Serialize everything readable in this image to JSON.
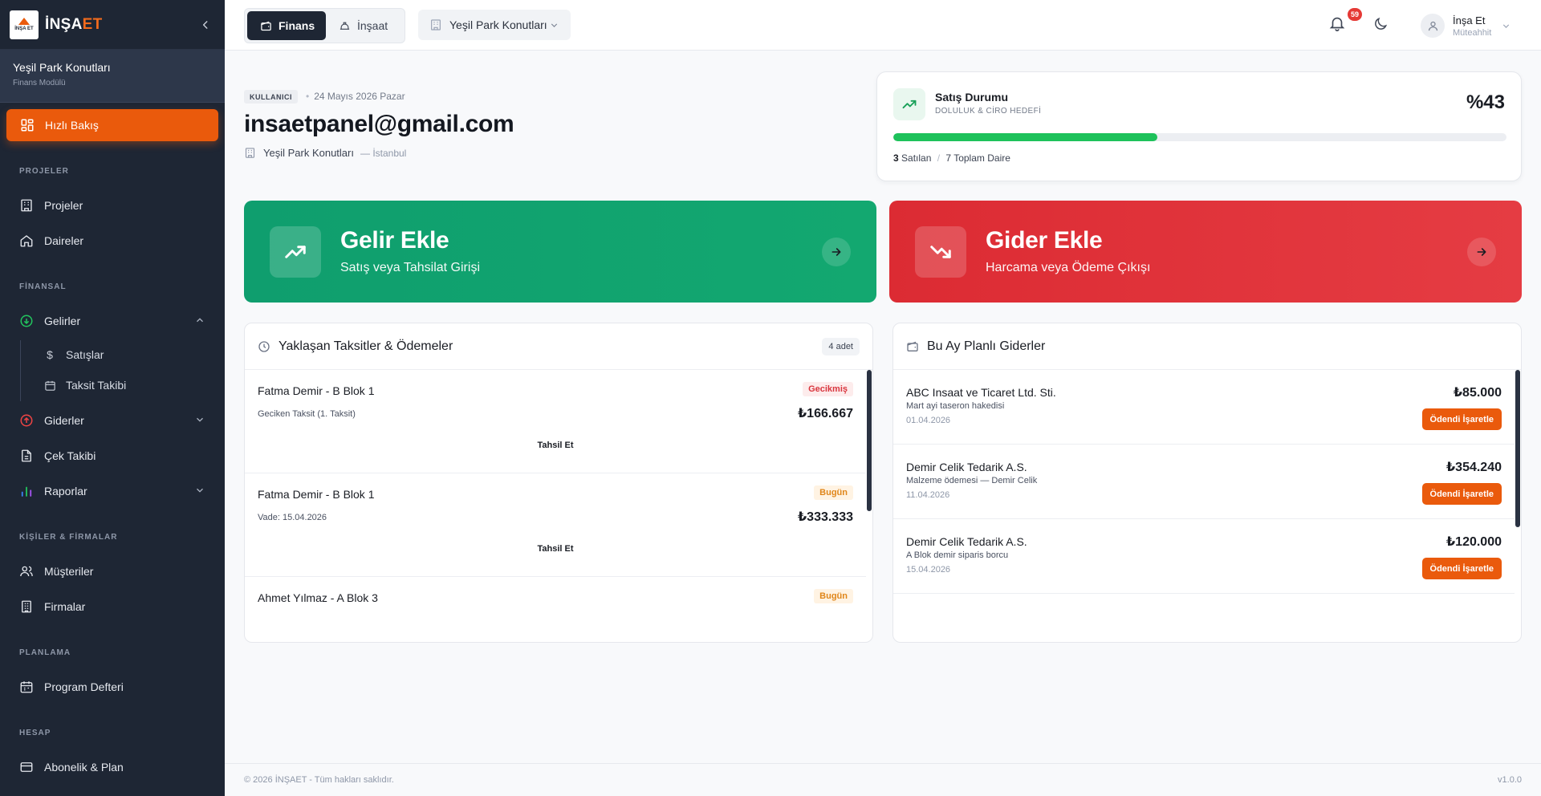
{
  "app": {
    "logo_small": "İNŞA ET",
    "logo_main": "İNŞA",
    "logo_accent": "ET"
  },
  "sidebar": {
    "project_name": "Yeşil Park Konutları",
    "project_module": "Finans Modülü",
    "active_item": "Hızlı Bakış",
    "sections": {
      "projects": "PROJELER",
      "finance": "FİNANSAL",
      "people": "KİŞİLER & FİRMALAR",
      "planning": "PLANLAMA",
      "account": "HESAP"
    },
    "items": {
      "projeler": "Projeler",
      "daireler": "Daireler",
      "gelirler": "Gelirler",
      "satislar": "Satışlar",
      "taksit_takibi": "Taksit Takibi",
      "giderler": "Giderler",
      "cek_takibi": "Çek Takibi",
      "raporlar": "Raporlar",
      "musteriler": "Müşteriler",
      "firmalar": "Firmalar",
      "program_defteri": "Program Defteri",
      "abonelik": "Abonelik & Plan"
    }
  },
  "topbar": {
    "mode_finance": "Finans",
    "mode_construction": "İnşaat",
    "project_select": "Yeşil Park Konutları",
    "notification_count": "59",
    "user_name": "İnşa Et",
    "user_role": "Müteahhit"
  },
  "header": {
    "role_chip": "KULLANICI",
    "date": "24 Mayıs 2026 Pazar",
    "email": "insaetpanel@gmail.com",
    "project": "Yeşil Park Konutları",
    "city": "— İstanbul"
  },
  "sales": {
    "title": "Satış Durumu",
    "subtitle": "DOLULUK & CİRO HEDEFİ",
    "percent_label": "%43",
    "progress_fraction": 0.43,
    "sold_count": "3",
    "sold_label": "Satılan",
    "total_label": "7 Toplam Daire",
    "accent": "#1ec25b"
  },
  "actions": {
    "income_title": "Gelir Ekle",
    "income_sub": "Satış veya Tahsilat Girişi",
    "expense_title": "Gider Ekle",
    "expense_sub": "Harcama veya Ödeme Çıkışı",
    "income_color": "#0f9e6e",
    "expense_color": "#dc2b33"
  },
  "installments": {
    "title": "Yaklaşan Taksitler & Ödemeler",
    "count": "4 adet",
    "collect_label": "Tahsil Et",
    "rows": [
      {
        "who": "Fatma Demir - B Blok 1",
        "status": "Gecikmiş",
        "desc": "Geciken Taksit (1. Taksit)",
        "amount": "₺166.667"
      },
      {
        "who": "Fatma Demir - B Blok 1",
        "status": "Bugün",
        "desc": "Vade: 15.04.2026",
        "amount": "₺333.333"
      },
      {
        "who": "Ahmet Yılmaz - A Blok 3",
        "status": "Bugün"
      }
    ]
  },
  "expenses": {
    "title": "Bu Ay Planlı Giderler",
    "mark_label": "Ödendi İşaretle",
    "rows": [
      {
        "firm": "ABC Insaat ve Ticaret Ltd. Sti.",
        "note": "Mart ayi taseron hakedisi",
        "date": "01.04.2026",
        "amount": "₺85.000"
      },
      {
        "firm": "Demir Celik Tedarik A.S.",
        "note": "Malzeme ödemesi — Demir Celik",
        "date": "11.04.2026",
        "amount": "₺354.240"
      },
      {
        "firm": "Demir Celik Tedarik A.S.",
        "note": "A Blok demir siparis borcu",
        "date": "15.04.2026",
        "amount": "₺120.000"
      }
    ]
  },
  "footer": {
    "copyright": "© 2026 İNŞAET - Tüm hakları saklıdır.",
    "version": "v1.0.0"
  }
}
